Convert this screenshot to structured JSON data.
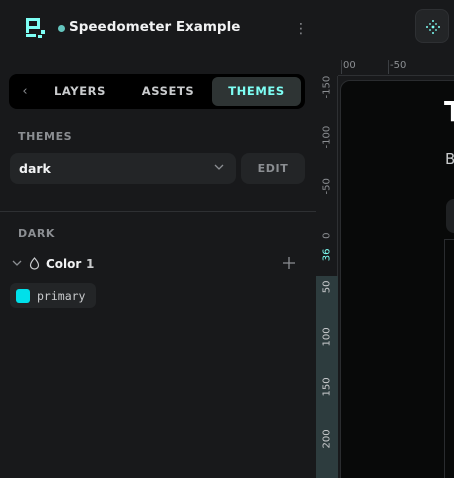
{
  "header": {
    "project_name": "Speedometer Example"
  },
  "tabs": [
    {
      "label": "LAYERS"
    },
    {
      "label": "ASSETS"
    },
    {
      "label": "THEMES",
      "active": true
    }
  ],
  "themes_section": {
    "title": "THEMES",
    "selected_theme": "dark",
    "edit_label": "EDIT"
  },
  "theme_detail": {
    "title": "DARK",
    "groups": [
      {
        "name": "Color",
        "count": "1",
        "tokens": [
          {
            "name": "primary",
            "color": "#00e0ea"
          }
        ]
      }
    ]
  },
  "rulers": {
    "horizontal": [
      "00",
      "-50"
    ],
    "vertical": [
      "-150",
      "-100",
      "-50",
      "0",
      "36",
      "50",
      "100",
      "150",
      "200"
    ]
  },
  "canvas": {
    "title_fragment": "T",
    "subtitle_fragment": "B"
  },
  "colors": {
    "accent": "#7efff5",
    "background": "#18191b",
    "token_primary": "#00e0ea"
  },
  "icons": [
    "app-logo-icon",
    "more-options-icon",
    "chevron-left-icon",
    "chevron-down-icon",
    "color-drop-icon",
    "add-icon",
    "move-tool-icon"
  ]
}
